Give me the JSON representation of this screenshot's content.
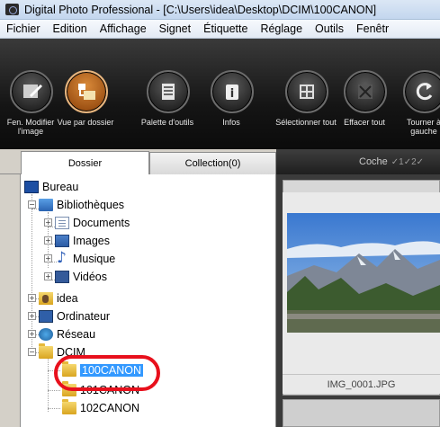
{
  "window": {
    "title": "Digital Photo Professional - [C:\\Users\\idea\\Desktop\\DCIM\\100CANON]"
  },
  "menu": [
    "Fichier",
    "Edition",
    "Affichage",
    "Signet",
    "Étiquette",
    "Réglage",
    "Outils",
    "Fenêtr"
  ],
  "toolbar": {
    "buttons": [
      {
        "label": "Fen. Modifier l'image",
        "icon": "edit-image-icon"
      },
      {
        "label": "Vue par dossier",
        "icon": "folder-view-icon"
      },
      {
        "label": "Palette d'outils",
        "icon": "tool-palette-icon"
      },
      {
        "label": "Infos",
        "icon": "info-icon"
      },
      {
        "label": "Sélectionner tout",
        "icon": "select-all-icon"
      },
      {
        "label": "Effacer tout",
        "icon": "clear-all-icon"
      },
      {
        "label": "Tourner à gauche",
        "icon": "rotate-left-icon"
      }
    ]
  },
  "tabs": {
    "folder": "Dossier",
    "collection": "Collection(0)"
  },
  "check_header": {
    "label": "Coche",
    "marks": "✓1✓2✓"
  },
  "tree": {
    "desktop": "Bureau",
    "libraries": "Bibliothèques",
    "documents": "Documents",
    "images": "Images",
    "music": "Musique",
    "videos": "Vidéos",
    "user": "idea",
    "computer": "Ordinateur",
    "network": "Réseau",
    "dcim": "DCIM",
    "canon100": "100CANON",
    "canon101": "101CANON",
    "canon102": "102CANON"
  },
  "thumbnail": {
    "filename": "IMG_0001.JPG"
  },
  "colors": {
    "selection": "#3399ff",
    "highlight_ring": "#e8101c",
    "active_button": "#c8741f"
  }
}
